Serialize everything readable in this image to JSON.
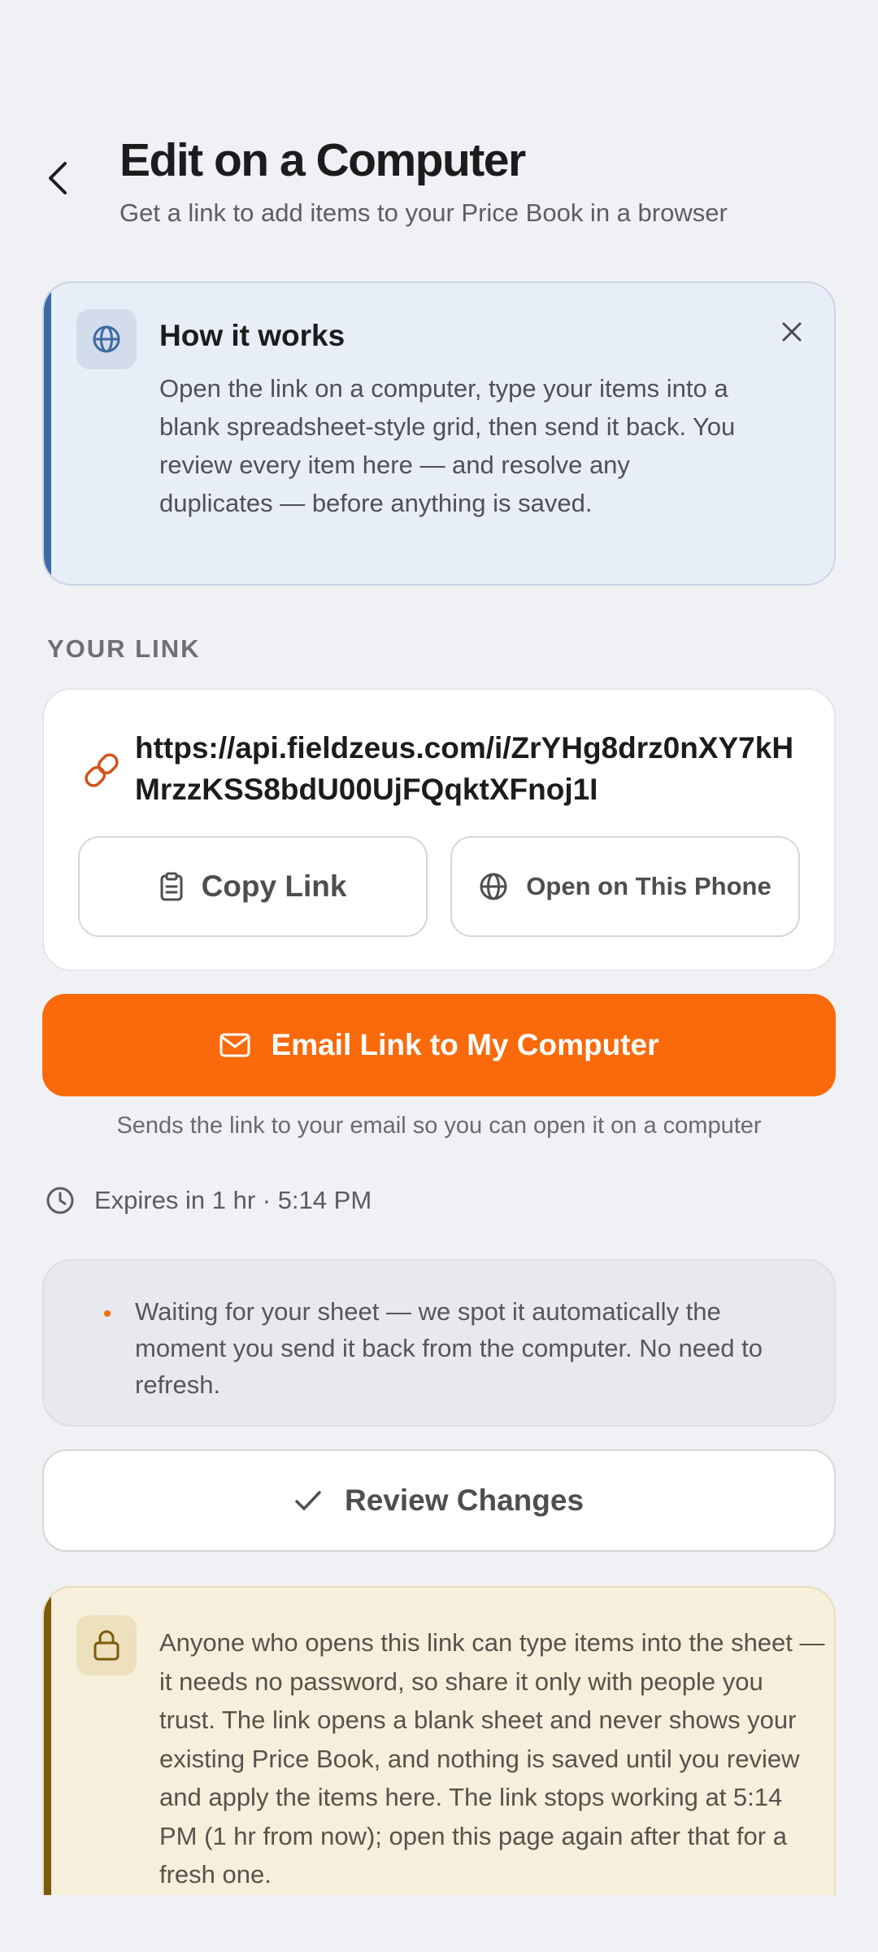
{
  "header": {
    "title": "Edit on a Computer",
    "subtitle": "Get a link to add items to your Price Book in a browser"
  },
  "info": {
    "title": "How it works",
    "body": "Open the link on a computer, type your items into a blank spreadsheet-style grid, then send it back. You review every item here — and resolve any duplicates — before anything is saved."
  },
  "link_section": {
    "label": "YOUR LINK",
    "url": "https://api.fieldzeus.com/i/ZrYHg8drz0nXY7kHMrzzKSS8bdU00UjFQqktXFnoj1I",
    "copy_label": "Copy Link",
    "open_label": "Open on This Phone"
  },
  "email": {
    "button_label": "Email Link to My Computer",
    "hint": "Sends the link to your email so you can open it on a computer"
  },
  "expiry": {
    "text": "Expires in 1 hr · 5:14 PM"
  },
  "waiting": {
    "text": "Waiting for your sheet — we spot it automatically the moment you send it back from the computer. No need to refresh."
  },
  "review": {
    "label": "Review Changes"
  },
  "warning": {
    "text": "Anyone who opens this link can type items into the sheet — it needs no password, so share it only with people you trust. The link opens a blank sheet and never shows your existing Price Book, and nothing is saved until you review and apply the items here. The link stops working at 5:14 PM (1 hr from now); open this page again after that for a fresh one."
  },
  "colors": {
    "accent_orange": "#fa6a0a",
    "info_accent": "#3d6aa3",
    "warning_accent": "#7c5a0b",
    "background": "#f0f1f4"
  },
  "icons": {
    "back": "chevron-left-icon",
    "info": "globe-icon",
    "close": "close-icon",
    "link": "link-icon",
    "copy": "clipboard-icon",
    "open": "globe-icon",
    "email": "mail-icon",
    "expiry": "clock-icon",
    "review": "check-icon",
    "warning": "lock-icon"
  }
}
